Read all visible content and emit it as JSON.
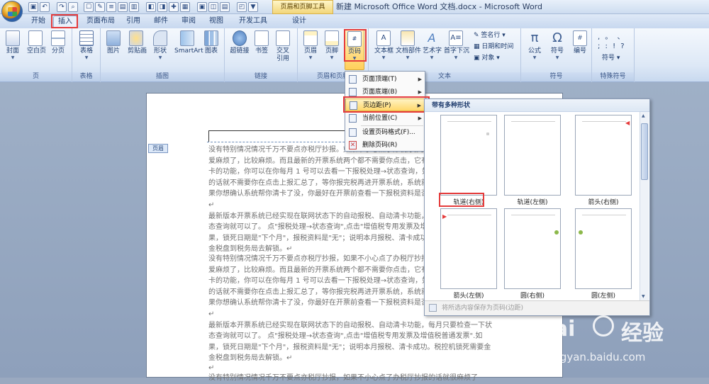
{
  "window": {
    "title": "新建 Microsoft Office Word 文档.docx - Microsoft Word",
    "context_title": "页眉和页脚工具"
  },
  "tabs": [
    {
      "label": "开始"
    },
    {
      "label": "插入"
    },
    {
      "label": "页面布局"
    },
    {
      "label": "引用"
    },
    {
      "label": "邮件"
    },
    {
      "label": "审阅"
    },
    {
      "label": "视图"
    },
    {
      "label": "开发工具"
    },
    {
      "label": "设计"
    }
  ],
  "ribbon": {
    "groups": [
      {
        "label": "页",
        "buttons": [
          "封面",
          "空白页",
          "分页"
        ]
      },
      {
        "label": "表格",
        "buttons": [
          "表格"
        ]
      },
      {
        "label": "插图",
        "buttons": [
          "图片",
          "剪贴画",
          "形状",
          "SmartArt",
          "图表"
        ]
      },
      {
        "label": "链接",
        "buttons": [
          "超链接",
          "书签",
          "交叉\n引用"
        ]
      },
      {
        "label": "页眉和页脚",
        "buttons": [
          "页眉",
          "页脚",
          "页码"
        ]
      },
      {
        "label": "文本",
        "buttons": [
          "文本框",
          "文档部件",
          "艺术字",
          "首字下沉"
        ],
        "small": [
          "签名行",
          "日期和时间",
          "对象"
        ]
      },
      {
        "label": "符号",
        "buttons": [
          "公式",
          "符号",
          "编号"
        ]
      },
      {
        "label": "特殊符号",
        "buttons": [
          "符号"
        ],
        "glyphs": ", 。 、 ; : ! ?"
      }
    ]
  },
  "dropdown_menu": {
    "items": [
      {
        "label": "页面顶端(T)",
        "submenu": true
      },
      {
        "label": "页面底端(B)",
        "submenu": true
      },
      {
        "label": "页边距(P)",
        "submenu": true,
        "highlighted": true
      },
      {
        "label": "当前位置(C)",
        "submenu": true
      },
      {
        "label": "设置页码格式(F)...",
        "submenu": false
      },
      {
        "label": "删除页码(R)",
        "submenu": false
      }
    ]
  },
  "gallery": {
    "heading": "带有多种形状",
    "items": [
      {
        "label": "轨道(右侧)",
        "marker": "gray-tick-right"
      },
      {
        "label": "轨道(左侧)",
        "marker": "none"
      },
      {
        "label": "箭头(右侧)",
        "marker": "red-arrow-right"
      },
      {
        "label": "箭头(左侧)",
        "marker": "red-arrow-left"
      },
      {
        "label": "圆(右侧)",
        "marker": "green-dot-right"
      },
      {
        "label": "圆(左侧)",
        "marker": "green-dot-left"
      }
    ],
    "footer": "将所选内容保存为页码(边距)"
  },
  "document": {
    "header_tag": "页眉",
    "paragraphs": [
      "没有特别情况情况千万不要点亦税厅抄报。如果不小心点了办税厅抄报的话就很麻烦了，",
      "爱麻烦了，比较麻烦。而且最新的开票系统两个都不需要你点击，它有个自动清卡",
      "卡的功能，你可以在你每月 1 号可以去看一下报税处理→状态查询，如果已经清卡",
      "的话就不需要你在点击上报汇总了，等你报完税再进开票系统，系统就自动清卡了。",
      "果你想确认系统帮你清卡了没，你最好在开票前查看一下报税资料是否已成功。",
      "↵",
      "最新版本开票系统已经实现在联网状态下的自动报税、自动清卡功能，每月只要检查一下状",
      "态查询就可以了。     点\"报税处理→状态查询\",点击\"增值税专用发票及增值税普通发票\".如",
      "果，锁死日期是\"下个月\"，报税资料是\"无\"；说明本月报税、清卡成功。税控机锁死需要",
      "金税盘到税务局去解锁。↵",
      "没有特别情况情况千万不要点亦税厅抄报，如果不小心点了办税厅抄报的话就很麻烦了，",
      "爱麻烦了，比较麻烦。而且最新的开票系统两个都不需要你点击，它有个自动清卡",
      "卡的功能，你可以在你每月 1 号可以去看一下报税处理→状态查询，如果已经清卡",
      "的话就不需要你在点击上报汇总了，等你报完税再进开票系统，系统就自动清卡了。",
      "果你想确认系统帮你清卡了没，你最好在开票前查看一下报税资料是否已成功。",
      "↵",
      "最新版本开票系统已经实现在联网状态下的自动报税、自动清卡功能，每月只要检查一下状",
      "态查询就可以了。     点\"报税处理→状态查询\",点击\"增值税专用发票及增值税普通发票\".如",
      "果，锁死日期是\"下个月\"，报税资料是\"无\"；说明本月报税、清卡成功。税控机锁死需要金",
      "金税盘到税务局去解锁。↵",
      "↵",
      "没有特别情况情况千万不要点亦税厅抄报，如果不小心点了办税厅抄报的话就很麻烦了"
    ]
  },
  "watermark": {
    "brand": "Bai",
    "brand2": "经验",
    "url": "jingyan.baidu.com"
  },
  "colors": {
    "highlight_box": "#e53b3b",
    "menu_highlight": "#ffd86b"
  }
}
